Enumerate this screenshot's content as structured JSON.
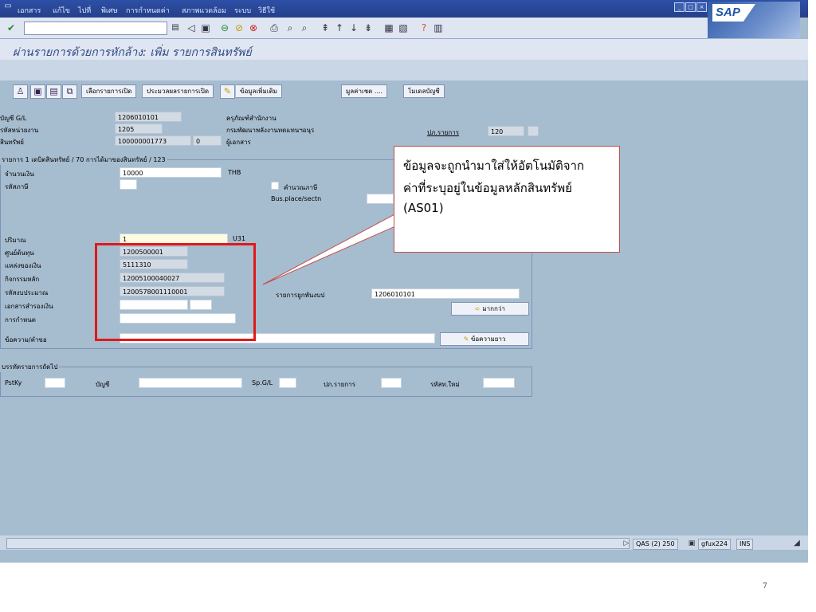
{
  "menu": [
    "เอกสาร",
    "แก้ไข",
    "ไปที่",
    "พิเศษ",
    "การกำหนดค่า",
    "สภาพแวดล้อม",
    "ระบบ",
    "วิธีใช้"
  ],
  "logo": "SAP",
  "page_title": "ผ่านรายการด้วยการหักล้าง: เพิ่ม รายการสินทรัพย์",
  "app_toolbar": {
    "buttons": [
      "เลือกรายการเปิด",
      "ประมวลผลรายการเปิด",
      "ข้อมูลเพิ่มเติม",
      "มูลค่าเชต ....",
      "โมเดลบัญชี"
    ]
  },
  "header": {
    "gl_account_label": "บัญชี G/L",
    "gl_account": "1206010101",
    "gl_account_desc": "ครุภัณฑ์สำนักงาน",
    "company_code_label": "รหัสหน่วยงาน",
    "company_code": "1205",
    "company_name": "กรมพัฒนาพลังงานทดแทนฯอนุร",
    "posting_period_label": "ปภ.รายการ",
    "posting_period": "120",
    "asset_label": "สินทรัพย์",
    "asset": "100000001773",
    "asset_sub": "0",
    "doc_type_label": "ผู้เอกสาร"
  },
  "item_group": {
    "title": "รายการ 1 เดบิตสินทรัพย์ / 70 การได้มาของสินทรัพย์ / 123",
    "amount_label": "จำนวนเงิน",
    "amount": "10000",
    "currency": "THB",
    "tax_code_label": "รหัสภาษี",
    "calc_tax_label": "คำนวณภาษี",
    "bus_place_label": "Bus.place/sectn",
    "quantity_label": "ปริมาณ",
    "quantity": "1",
    "unit": "U31",
    "cost_center_label": "ศูนย์ต้นทุน",
    "cost_center": "1200500001",
    "fund_label": "แหล่งของเงิน",
    "fund": "5111310",
    "functional_area_label": "กิจกรรมหลัก",
    "functional_area": "12005100040027",
    "budget_code_label": "รหัสงบประมาณ",
    "budget_code": "1200578001110001",
    "earmarked_label": "เอกสารสำรองเงิน",
    "assignment_label": "การกำหนด",
    "text_label": "ข้อความ/คำขอ",
    "trading_partner_label": "รายการยูกพันงบป",
    "trading_partner": "1206010101",
    "more_button": "มากกว่า",
    "long_text_button": "ข้อความยาว"
  },
  "next_item": {
    "title": "บรรทัดรายการถัดไป",
    "pstky_label": "PstKy",
    "account_label": "บัญชี",
    "spgl_label": "Sp.G/L",
    "trans_type_label": "ปภ.รายการ",
    "new_code_label": "รหัสท.ใหม่"
  },
  "status_bar": {
    "system": "QAS (2) 250",
    "server": "gfux224",
    "mode": "INS"
  },
  "callout": {
    "line1": "ข้อมูลจะถูกนำมาใส่ให้อัตโนมัติจาก",
    "line2": "ค่าที่ระบุอยู่ในข้อมูลหลักสินทรัพย์",
    "line3": "(AS01)"
  },
  "slide_number": "7"
}
